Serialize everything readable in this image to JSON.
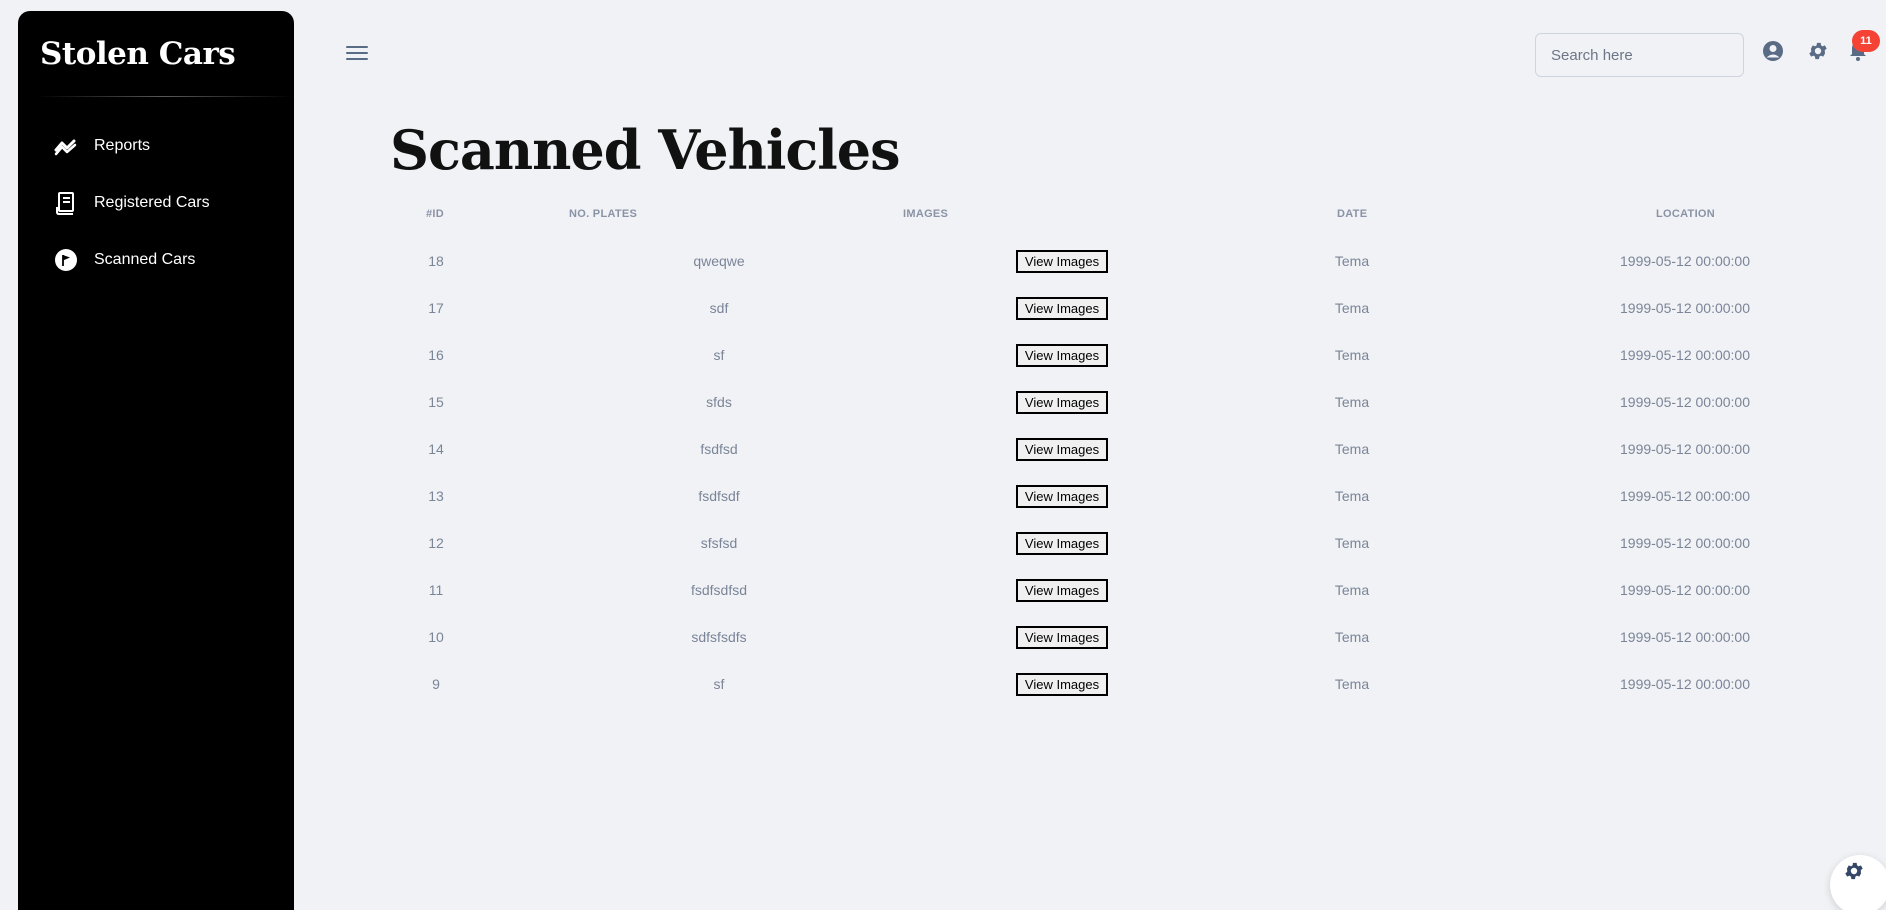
{
  "sidebar": {
    "brand": "Stolen Cars",
    "items": [
      {
        "label": "Reports",
        "icon": "trending-icon"
      },
      {
        "label": "Registered Cars",
        "icon": "receipt-icon"
      },
      {
        "label": "Scanned Cars",
        "icon": "flag-icon"
      }
    ]
  },
  "header": {
    "search_placeholder": "Search here",
    "notification_count": "11"
  },
  "main": {
    "title": "Scanned Vehicles",
    "columns": [
      "#ID",
      "NO. PLATES",
      "IMAGES",
      "DATE",
      "LOCATION"
    ],
    "rows": [
      {
        "id": "18",
        "plate": "qweqwe",
        "button": "View Images",
        "date": "Tema",
        "location": "1999-05-12 00:00:00"
      },
      {
        "id": "17",
        "plate": "sdf",
        "button": "View Images",
        "date": "Tema",
        "location": "1999-05-12 00:00:00"
      },
      {
        "id": "16",
        "plate": "sf",
        "button": "View Images",
        "date": "Tema",
        "location": "1999-05-12 00:00:00"
      },
      {
        "id": "15",
        "plate": "sfds",
        "button": "View Images",
        "date": "Tema",
        "location": "1999-05-12 00:00:00"
      },
      {
        "id": "14",
        "plate": "fsdfsd",
        "button": "View Images",
        "date": "Tema",
        "location": "1999-05-12 00:00:00"
      },
      {
        "id": "13",
        "plate": "fsdfsdf",
        "button": "View Images",
        "date": "Tema",
        "location": "1999-05-12 00:00:00"
      },
      {
        "id": "12",
        "plate": "sfsfsd",
        "button": "View Images",
        "date": "Tema",
        "location": "1999-05-12 00:00:00"
      },
      {
        "id": "11",
        "plate": "fsdfsdfsd",
        "button": "View Images",
        "date": "Tema",
        "location": "1999-05-12 00:00:00"
      },
      {
        "id": "10",
        "plate": "sdfsfsdfs",
        "button": "View Images",
        "date": "Tema",
        "location": "1999-05-12 00:00:00"
      },
      {
        "id": "9",
        "plate": "sf",
        "button": "View Images",
        "date": "Tema",
        "location": "1999-05-12 00:00:00"
      }
    ]
  },
  "colors": {
    "background": "#f0f2f5",
    "sidebar": "#000000",
    "badge": "#f44335",
    "muted_text": "#7b8598"
  }
}
